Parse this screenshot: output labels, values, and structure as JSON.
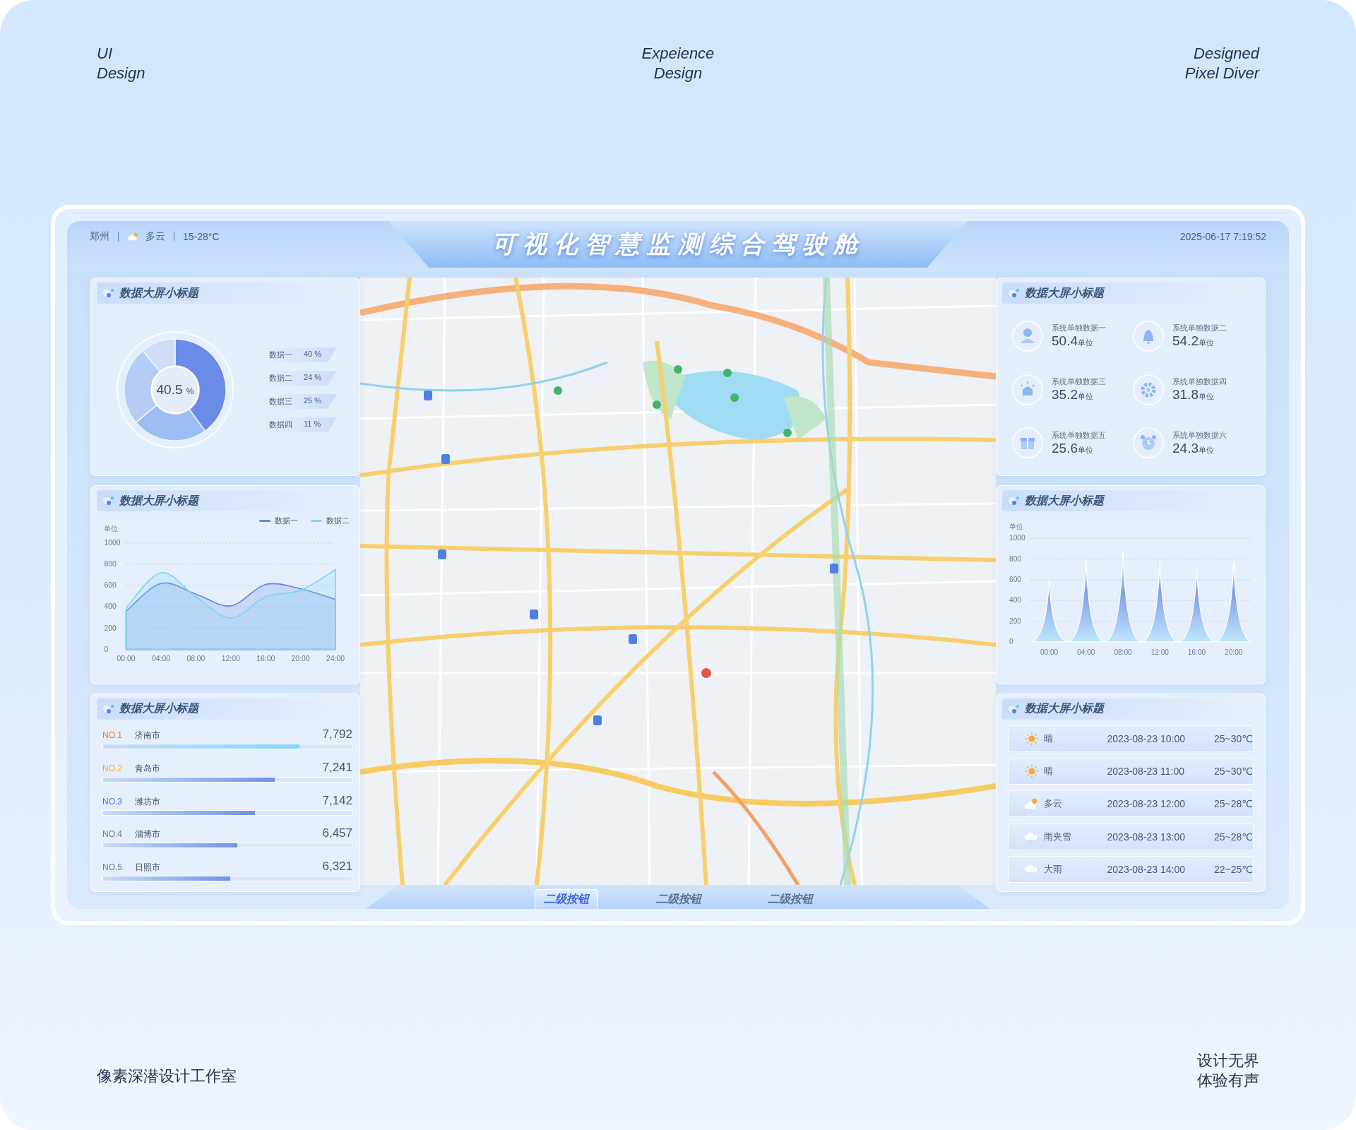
{
  "corners": {
    "top_left": "UI\nDesign",
    "top_center": "Expeience\nDesign",
    "top_right": "Designed\nPixel Diver",
    "bottom_left": "像素深潜设计工作室",
    "bottom_right": [
      "设计无界",
      "体验有声"
    ]
  },
  "header": {
    "city": "郑州",
    "weather": "多云",
    "temperature": "15-28°C",
    "title": "可视化智慧监测综合驾驶舱",
    "datetime": "2025-06-17 7:19:52"
  },
  "left_panels": {
    "donut_panel": {
      "title": "数据大屏小标题",
      "center_value": "40.5",
      "center_unit": "%",
      "legend": [
        {
          "value": "40 %"
        },
        {
          "value": "24 %"
        },
        {
          "value": "25 %"
        },
        {
          "value": "11 %"
        }
      ],
      "chart_data": {
        "type": "donut",
        "categories": [
          "数据一",
          "数据二",
          "数据三",
          "数据四"
        ],
        "values": [
          40,
          24,
          25,
          11
        ]
      }
    },
    "line_panel": {
      "title": "数据大屏小标题",
      "chart_data": {
        "type": "area",
        "grid": true,
        "ylabel": "单位",
        "categories": [
          "00:00",
          "04:00",
          "08:00",
          "12:00",
          "16:00",
          "20:00",
          "24:00"
        ],
        "ylim": [
          0,
          1000
        ],
        "yticks": [
          0,
          200,
          400,
          600,
          800,
          1000
        ],
        "series": [
          {
            "name": "数据一",
            "color": "#6a86e0",
            "values": [
              360,
              620,
              520,
              410,
              610,
              570,
              470
            ]
          },
          {
            "name": "数据二",
            "color": "#7ad8f2",
            "values": [
              390,
              720,
              495,
              295,
              495,
              555,
              750
            ]
          }
        ]
      }
    },
    "ranking_panel": {
      "title": "数据大屏小标题",
      "items": [
        {
          "rank": "NO.1",
          "color": "#f5733a",
          "name": "济南市",
          "value": "7,792",
          "level": 0.79
        },
        {
          "rank": "NO.2",
          "color": "#f7a733",
          "name": "青岛市",
          "value": "7,241",
          "level": 0.69
        },
        {
          "rank": "NO.3",
          "color": "#3d74f0",
          "name": "潍坊市",
          "value": "7,142",
          "level": 0.61
        },
        {
          "rank": "NO.4",
          "color": "#6d7c93",
          "name": "淄博市",
          "value": "6,457",
          "level": 0.54
        },
        {
          "rank": "NO.5",
          "color": "#6d7c93",
          "name": "日照市",
          "value": "6,321",
          "level": 0.51
        }
      ]
    }
  },
  "right_panels": {
    "stats_panel": {
      "title": "数据大屏小标题",
      "items": [
        {
          "label": "系统单独数据一",
          "value": "50.4",
          "unit": "单位"
        },
        {
          "label": "系统单独数据二",
          "value": "54.2",
          "unit": "单位"
        },
        {
          "label": "系统单独数据三",
          "value": "35.2",
          "unit": "单位"
        },
        {
          "label": "系统单独数据四",
          "value": "31.8",
          "unit": "单位"
        },
        {
          "label": "系统单独数据五",
          "value": "25.6",
          "unit": "单位"
        },
        {
          "label": "系统单独数据六",
          "value": "24.3",
          "unit": "单位"
        }
      ]
    },
    "spike_panel": {
      "title": "数据大屏小标题",
      "chart_data": {
        "type": "area",
        "grid": true,
        "ylabel": "单位",
        "x": [
          -2,
          0,
          2,
          4,
          6,
          8,
          10,
          12,
          14,
          16,
          18,
          20,
          22
        ],
        "xlim": [
          -2,
          22
        ],
        "ylim": [
          0,
          1000
        ],
        "xticks": [
          {
            "value": 0,
            "label": "00:00"
          },
          {
            "value": 4,
            "label": "04:00"
          },
          {
            "value": 8,
            "label": "08:00"
          },
          {
            "value": 12,
            "label": "12:00"
          },
          {
            "value": 16,
            "label": "16:00"
          },
          {
            "value": 20,
            "label": "20:00"
          }
        ],
        "yticks": [
          0,
          200,
          400,
          600,
          800,
          1000
        ],
        "values": [
          0,
          600,
          0,
          800,
          0,
          880,
          0,
          790,
          0,
          720,
          0,
          780,
          0
        ]
      }
    },
    "weather_panel": {
      "title": "数据大屏小标题",
      "rows": [
        {
          "kind": "sunny",
          "condition": "晴",
          "time": "2023-08-23 10:00",
          "temperature": "25~30℃"
        },
        {
          "kind": "sunny",
          "condition": "晴",
          "time": "2023-08-23 11:00",
          "temperature": "25~30℃"
        },
        {
          "kind": "cloudy",
          "condition": "多云",
          "time": "2023-08-23 12:00",
          "temperature": "25~28℃"
        },
        {
          "kind": "rain",
          "condition": "雨夹雪",
          "time": "2023-08-23 13:00",
          "temperature": "25~28℃"
        },
        {
          "kind": "rain",
          "condition": "大雨",
          "time": "2023-08-23 14:00",
          "temperature": "22~25℃"
        }
      ]
    }
  },
  "bottom_tabs": [
    {
      "label": "二级按钮",
      "selected": true
    },
    {
      "label": "二级按钮",
      "selected": false
    },
    {
      "label": "二级按钮",
      "selected": false
    }
  ]
}
